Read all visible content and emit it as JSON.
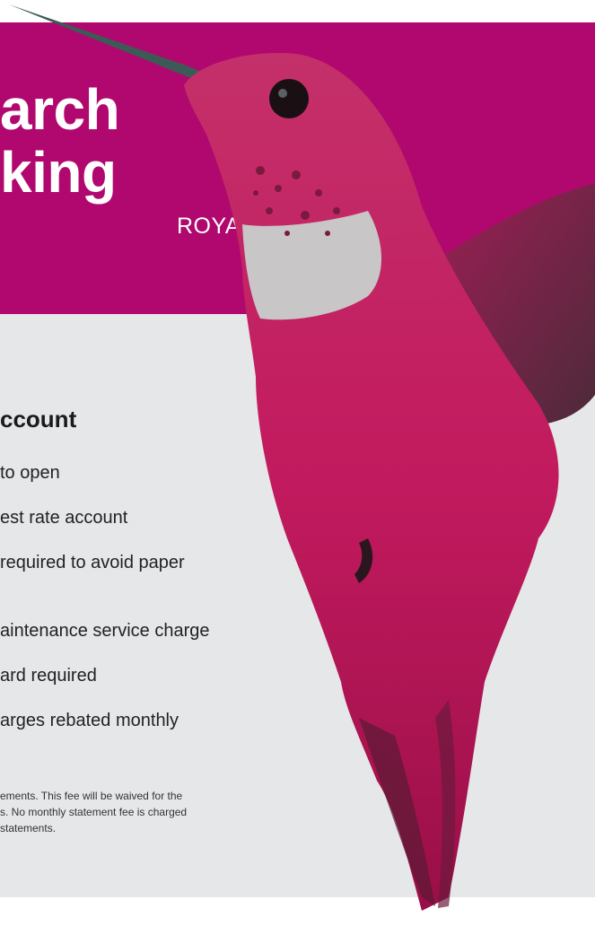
{
  "banner": {
    "title_line1": "arch",
    "title_line2": "king",
    "tagline": "ROYALTY"
  },
  "account": {
    "heading": "ccount",
    "features": [
      "to open",
      "est rate account",
      "required to avoid paper",
      "aintenance service charge",
      "ard required",
      "arges rebated monthly"
    ]
  },
  "footnote": {
    "lines": [
      "ements. This fee will be waived for the",
      "s. No monthly statement fee is charged",
      "statements."
    ]
  },
  "colors": {
    "banner": "#b0086e",
    "panel": "#e6e7e8",
    "bird": "#c21a5e"
  }
}
